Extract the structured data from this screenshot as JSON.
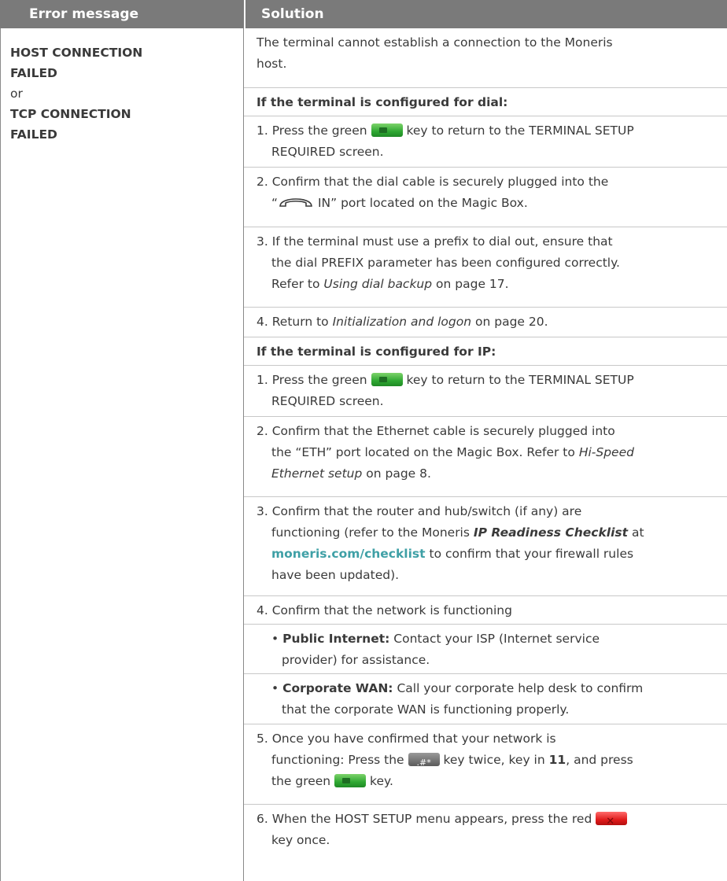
{
  "header": {
    "col1": "Error message",
    "col2": "Solution"
  },
  "errors": {
    "line1": "HOST CONNECTION",
    "line2": "FAILED",
    "or": "or",
    "line3": "TCP CONNECTION",
    "line4": "FAILED"
  },
  "solution": {
    "intro_a": "The terminal cannot establish a connection to the Moneris",
    "intro_b": "host.",
    "dial_heading": "If the terminal is configured for dial:",
    "dial_1a": "1. Press the green",
    "dial_1b": "key to return to the TERMINAL SETUP",
    "dial_1c": "REQUIRED screen.",
    "dial_2a": "2. Confirm that the dial cable is securely plugged into the",
    "dial_2b_open": "“",
    "dial_2b": "IN” port located on the Magic Box.",
    "dial_3a": "3. If the terminal must use a prefix to dial out, ensure that",
    "dial_3b": "the dial PREFIX parameter has been configured correctly.",
    "dial_3c_pre": "Refer to",
    "dial_3c_it": "Using dial backup",
    "dial_3c_post": "on page 17.",
    "dial_4_pre": "4. Return to",
    "dial_4_it": "Initialization and logon",
    "dial_4_post": "on page 20.",
    "ip_heading": "If the terminal is configured for IP:",
    "ip_1a": "1. Press the green",
    "ip_1b": "key to return to the TERMINAL SETUP",
    "ip_1c": "REQUIRED screen.",
    "ip_2a": "2. Confirm that the Ethernet cable is securely plugged into",
    "ip_2b_pre": "the “ETH” port located on the Magic Box. Refer to",
    "ip_2b_it": "Hi-Speed",
    "ip_2c_it": "Ethernet setup",
    "ip_2c_post": "on page 8.",
    "ip_3a": "3. Confirm that the router and hub/switch (if any) are",
    "ip_3b_pre": "functioning (refer to the Moneris",
    "ip_3b_bi": "IP Readiness Checklist",
    "ip_3b_post": "at",
    "ip_3c_link": "moneris.com/checklist",
    "ip_3c_post": "to confirm that your firewall rules",
    "ip_3d": "have been updated).",
    "ip_4": "4. Confirm that the network is functioning",
    "ip_4_b1_label": "Public Internet:",
    "ip_4_b1_text": "Contact your ISP (Internet service",
    "ip_4_b1_text2": "provider) for assistance.",
    "ip_4_b2_label": "Corporate WAN:",
    "ip_4_b2_text": "Call your corporate help desk to confirm",
    "ip_4_b2_text2": "that the corporate WAN is functioning properly.",
    "ip_5a": "5. Once you have confirmed that your network is",
    "ip_5b_pre": "functioning: Press the",
    "ip_5b_mid": "key twice, key in",
    "ip_5b_num": "11",
    "ip_5b_post": ", and press",
    "ip_5c_pre": "the green",
    "ip_5c_post": "key.",
    "ip_6a": "6. When the HOST SETUP menu appears, press the red",
    "ip_6b": "key once."
  },
  "colors": {
    "header_bg": "#7a7a7a",
    "link": "#3fa0a6",
    "green_key": "#2fa832",
    "red_key": "#e01b1b"
  }
}
